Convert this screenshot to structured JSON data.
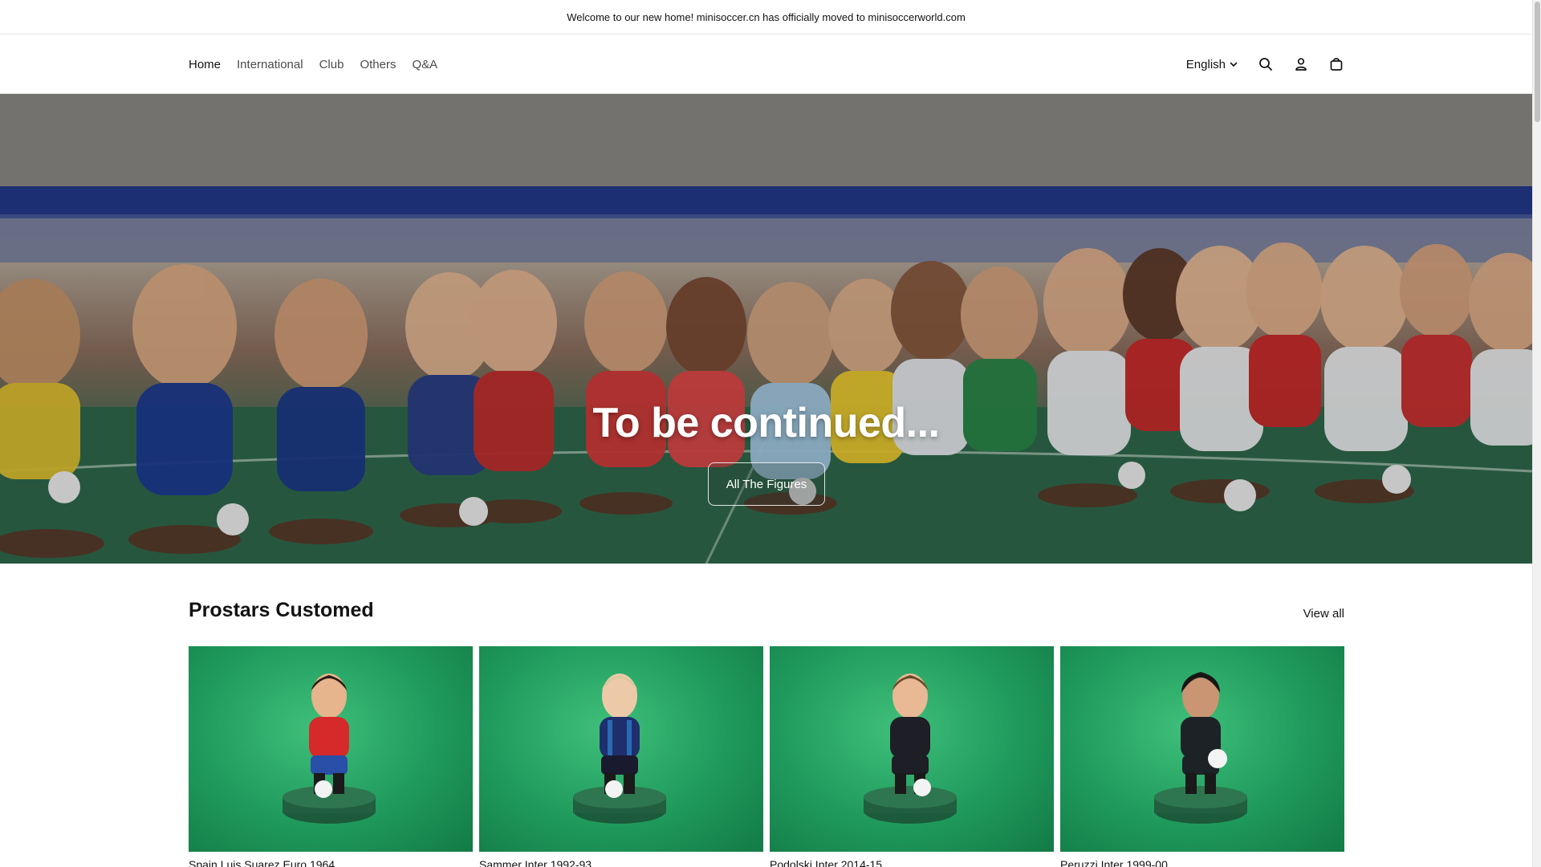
{
  "announcement": {
    "text": "Welcome to our new home! minisoccer.cn has officially moved to minisoccerworld.com"
  },
  "nav": {
    "items": [
      {
        "label": "Home",
        "active": true
      },
      {
        "label": "International",
        "active": false
      },
      {
        "label": "Club",
        "active": false
      },
      {
        "label": "Others",
        "active": false
      },
      {
        "label": "Q&A",
        "active": false
      }
    ]
  },
  "header_right": {
    "language": "English",
    "icons": [
      "search-icon",
      "account-icon",
      "cart-icon"
    ]
  },
  "hero": {
    "title": "To be continued...",
    "button_label": "All The Figures"
  },
  "collection": {
    "title": "Prostars Customed",
    "view_all_label": "View all",
    "products": [
      {
        "title": "Spain Luis Suarez Euro 1964",
        "shirt": "#d62a2a",
        "shorts": "#2a4fa8"
      },
      {
        "title": "Sammer Inter 1992-93",
        "shirt": "#1f2f6e",
        "shorts": "#1a1a2e"
      },
      {
        "title": "Podolski Inter 2014-15",
        "shirt": "#1e1e26",
        "shorts": "#1e1e26"
      },
      {
        "title": "Peruzzi Inter 1999-00",
        "shirt": "#1d2226",
        "shorts": "#1d2226"
      }
    ]
  },
  "colors": {
    "accent_text": "#121212",
    "muted_nav": "#4b4b4b",
    "card_green": "#1f9a5c"
  }
}
